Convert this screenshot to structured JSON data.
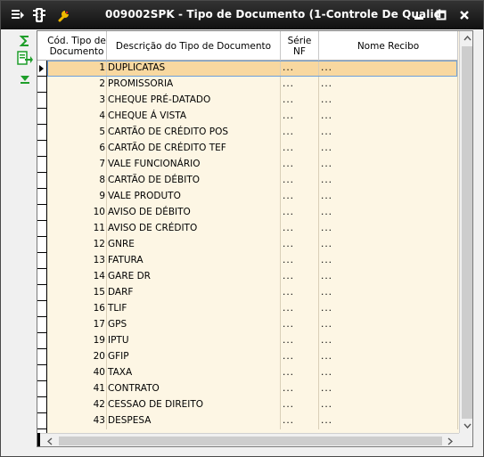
{
  "window": {
    "title": "009002SPK - Tipo de Documento (1-Controle De Qualid",
    "icons": [
      "window-menu-icon",
      "traffic-light-icon",
      "wrench-icon"
    ],
    "controls": [
      "minimize-icon",
      "maximize-icon",
      "close-icon"
    ]
  },
  "toolbar": {
    "buttons": [
      "sum-icon",
      "export-icon",
      "collapse-icon"
    ]
  },
  "grid": {
    "columns": [
      {
        "label": "Cód. Tipo de Documento"
      },
      {
        "label": "Descrição do Tipo de Documento"
      },
      {
        "label": "Série NF"
      },
      {
        "label": "Nome Recibo"
      }
    ],
    "rows": [
      {
        "code": "1",
        "desc": "DUPLICATAS",
        "serie": "...",
        "recibo": "..."
      },
      {
        "code": "2",
        "desc": "PROMISSORIA",
        "serie": "...",
        "recibo": "..."
      },
      {
        "code": "3",
        "desc": "CHEQUE PRÉ-DATADO",
        "serie": "...",
        "recibo": "..."
      },
      {
        "code": "4",
        "desc": "CHEQUE Á VISTA",
        "serie": "...",
        "recibo": "..."
      },
      {
        "code": "5",
        "desc": "CARTÃO DE CRÉDITO POS",
        "serie": "...",
        "recibo": "..."
      },
      {
        "code": "6",
        "desc": "CARTÃO DE CRÉDITO TEF",
        "serie": "...",
        "recibo": "..."
      },
      {
        "code": "7",
        "desc": "VALE FUNCIONÁRIO",
        "serie": "...",
        "recibo": "..."
      },
      {
        "code": "8",
        "desc": "CARTÃO DE DÉBITO",
        "serie": "...",
        "recibo": "..."
      },
      {
        "code": "9",
        "desc": "VALE PRODUTO",
        "serie": "...",
        "recibo": "..."
      },
      {
        "code": "10",
        "desc": "AVISO DE DÉBITO",
        "serie": "...",
        "recibo": "..."
      },
      {
        "code": "11",
        "desc": "AVISO DE CRÉDITO",
        "serie": "...",
        "recibo": "..."
      },
      {
        "code": "12",
        "desc": "GNRE",
        "serie": "...",
        "recibo": "..."
      },
      {
        "code": "13",
        "desc": "FATURA",
        "serie": "...",
        "recibo": "..."
      },
      {
        "code": "14",
        "desc": "GARE DR",
        "serie": "...",
        "recibo": "..."
      },
      {
        "code": "15",
        "desc": "DARF",
        "serie": "...",
        "recibo": "..."
      },
      {
        "code": "16",
        "desc": "TLIF",
        "serie": "...",
        "recibo": "..."
      },
      {
        "code": "17",
        "desc": "GPS",
        "serie": "...",
        "recibo": "..."
      },
      {
        "code": "19",
        "desc": "IPTU",
        "serie": "...",
        "recibo": "..."
      },
      {
        "code": "20",
        "desc": "GFIP",
        "serie": "...",
        "recibo": "..."
      },
      {
        "code": "40",
        "desc": "TAXA",
        "serie": "...",
        "recibo": "..."
      },
      {
        "code": "41",
        "desc": "CONTRATO",
        "serie": "...",
        "recibo": "..."
      },
      {
        "code": "42",
        "desc": "CESSAO DE DIREITO",
        "serie": "...",
        "recibo": "..."
      },
      {
        "code": "43",
        "desc": "DESPESA",
        "serie": "...",
        "recibo": "..."
      }
    ],
    "selected_row": 0
  },
  "colors": {
    "title_bg": "#1a1a1a",
    "grid_bg": "#fdf6e4",
    "selected_bg": "#f8d8a0",
    "toolbar_green": "#1e9e2a"
  }
}
